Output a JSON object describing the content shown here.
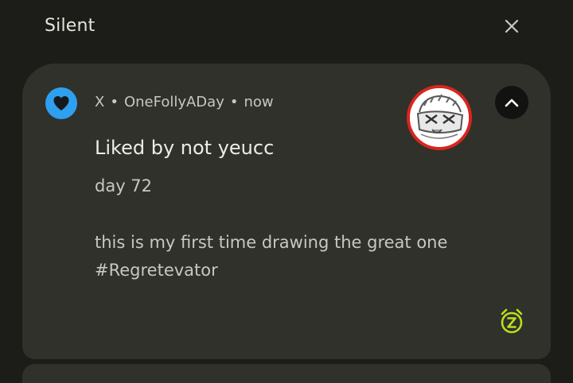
{
  "section": {
    "title": "Silent",
    "dismiss_icon": "close-icon"
  },
  "notification": {
    "app_icon": "heart-icon",
    "app_icon_color": "#2f9ff0",
    "app_name": "X",
    "account": "OneFollyADay",
    "time": "now",
    "title": "Liked by not yeucc",
    "subtitle": "day 72",
    "body_lines": [
      "this is my first time drawing the great one",
      "#Regretevator"
    ],
    "expand_icon": "chevron-up-icon",
    "snooze_icon": "snooze-alarm-icon",
    "snooze_color": "#b8e01a"
  }
}
